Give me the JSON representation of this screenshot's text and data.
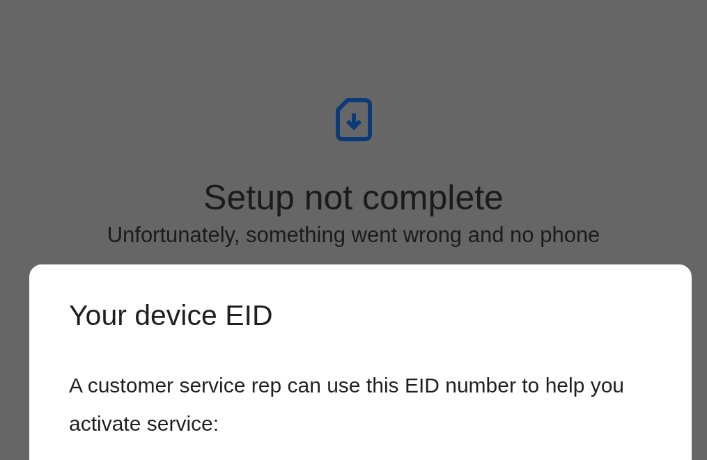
{
  "screen": {
    "title": "Setup not complete",
    "message": "Unfortunately, something went wrong and no phone"
  },
  "dialog": {
    "title": "Your device EID",
    "body": "A customer service rep can use this EID number to help you activate service:"
  }
}
